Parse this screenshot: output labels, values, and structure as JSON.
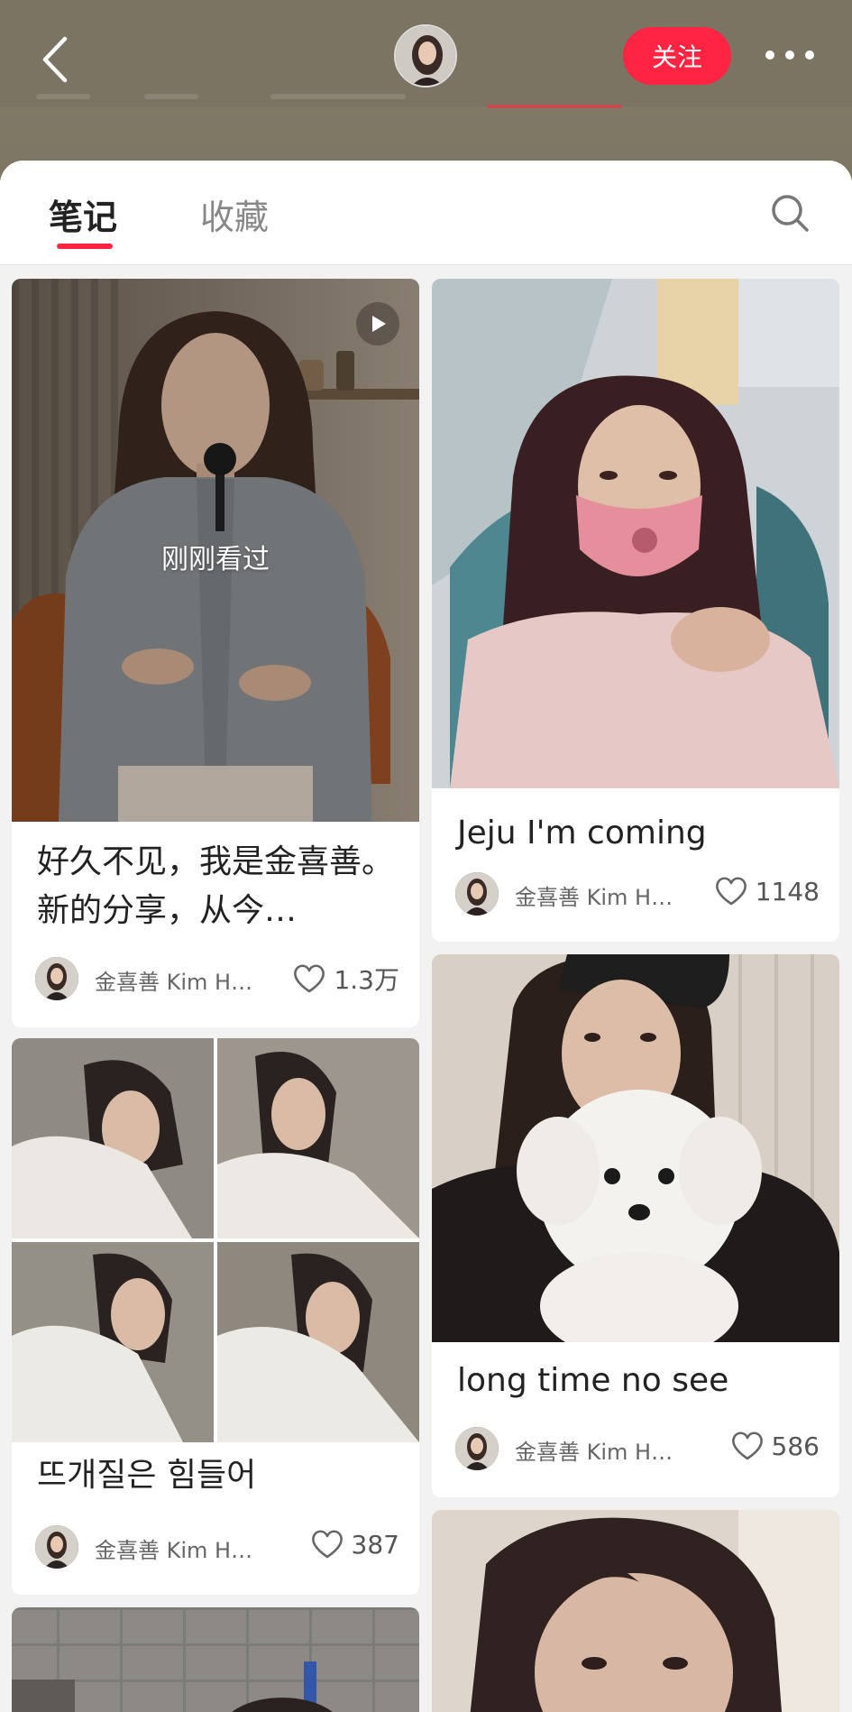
{
  "header": {
    "follow_label": "关注"
  },
  "tabs": [
    {
      "label": "笔记"
    },
    {
      "label": "收藏"
    }
  ],
  "colors": {
    "accent": "#ff2442",
    "header_bg": "#7b7463"
  },
  "notes": [
    {
      "title": "好久不见，我是金喜善。新的分享，从今…",
      "overlay": "刚刚看过",
      "author": "金喜善 Kim H…",
      "likes": "1.3万",
      "is_video": true
    },
    {
      "title": "Jeju I'm coming",
      "author": "金喜善 Kim H…",
      "likes": "1148"
    },
    {
      "title": "뜨개질은 힘들어",
      "author": "金喜善 Kim H…",
      "likes": "387"
    },
    {
      "title": "long time no see",
      "author": "金喜善 Kim H…",
      "likes": "586"
    }
  ]
}
